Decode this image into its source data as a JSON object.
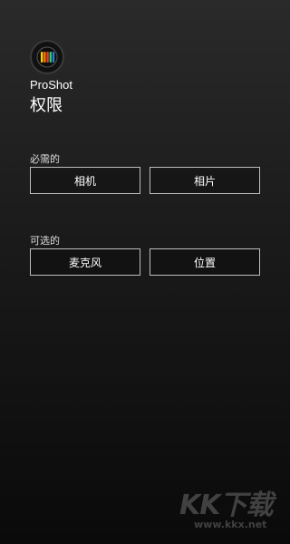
{
  "app": {
    "name": "ProShot",
    "logo_icon": "proshot-logo-icon",
    "logo_bar_colors": [
      "#ffd400",
      "#ff7a00",
      "#e63b2e",
      "#2ecc71",
      "#2d7dd2"
    ]
  },
  "page": {
    "title": "权限"
  },
  "sections": {
    "required": {
      "label": "必需的",
      "buttons": [
        "相机",
        "相片"
      ]
    },
    "optional": {
      "label": "可选的",
      "buttons": [
        "麦克风",
        "位置"
      ]
    }
  },
  "watermark": {
    "text": "KK下载",
    "url": "www.kkx.net"
  },
  "colors": {
    "background_top": "#2a2a2a",
    "background_bottom": "#0a0a0a",
    "button_border": "#bdbdbd",
    "text": "#ffffff"
  }
}
